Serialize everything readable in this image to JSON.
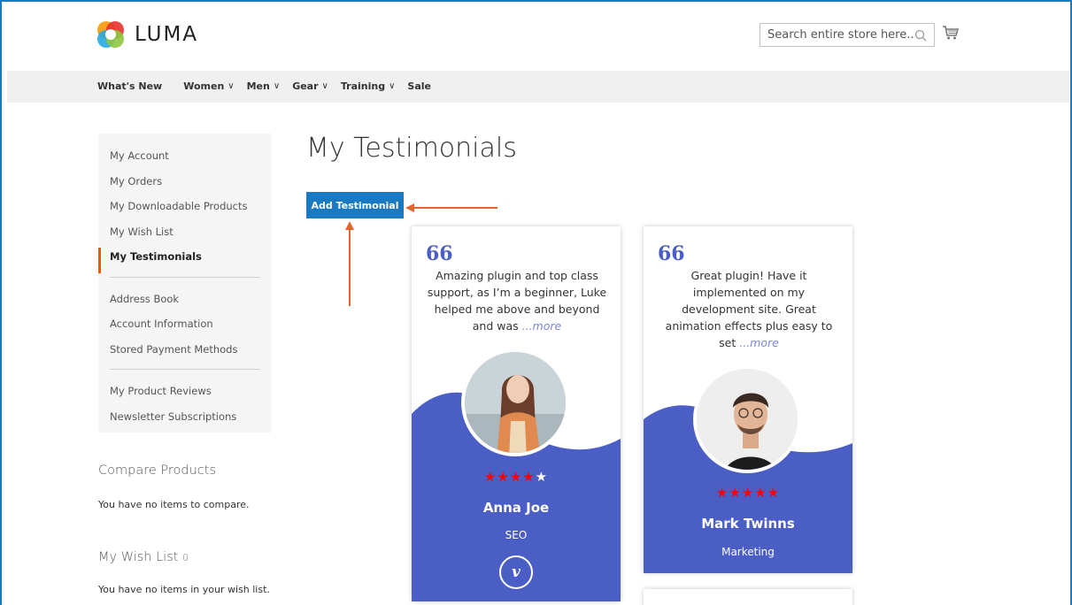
{
  "header": {
    "logo_text": "LUMA",
    "search_placeholder": "Search entire store here...",
    "icons": {
      "search": "search-icon",
      "cart": "cart-icon"
    }
  },
  "nav": {
    "items": [
      {
        "label": "What's New",
        "has_dropdown": false
      },
      {
        "label": "Women",
        "has_dropdown": true
      },
      {
        "label": "Men",
        "has_dropdown": true
      },
      {
        "label": "Gear",
        "has_dropdown": true
      },
      {
        "label": "Training",
        "has_dropdown": true
      },
      {
        "label": "Sale",
        "has_dropdown": false
      }
    ],
    "chevron": "∨"
  },
  "sidebar": {
    "items": [
      "My Account",
      "My Orders",
      "My Downloadable Products",
      "My Wish List",
      "My Testimonials",
      "Address Book",
      "Account Information",
      "Stored Payment Methods",
      "My Product Reviews",
      "Newsletter Subscriptions"
    ],
    "active": "My Testimonials"
  },
  "compare": {
    "title": "Compare Products",
    "empty_text": "You have no items to compare."
  },
  "wishlist": {
    "title": "My Wish List",
    "count": "0",
    "empty_text": "You have no items in your wish list."
  },
  "main": {
    "page_title": "My Testimonials",
    "add_button": "Add Testimonial"
  },
  "testimonials": [
    {
      "quote_mark": "66",
      "text": "Amazing plugin and top class support, as I’m a beginner, Luke helped me above and beyond and was",
      "more": "...more",
      "rating": 4,
      "max_rating": 5,
      "name": "Anna Joe",
      "role": "SEO",
      "social_icon": "vimeo-icon",
      "social_glyph": "v"
    },
    {
      "quote_mark": "66",
      "text": "Great plugin! Have it implemented on my development site. Great animation effects plus easy to set",
      "more": "...more",
      "rating": 5,
      "max_rating": 5,
      "name": "Mark Twinns",
      "role": "Marketing"
    }
  ],
  "colors": {
    "accent": "#1979c3",
    "card_wave": "#4a5ec6",
    "active_marker": "#ff5501",
    "arrow": "#e0662a",
    "star": "#ff0000"
  }
}
